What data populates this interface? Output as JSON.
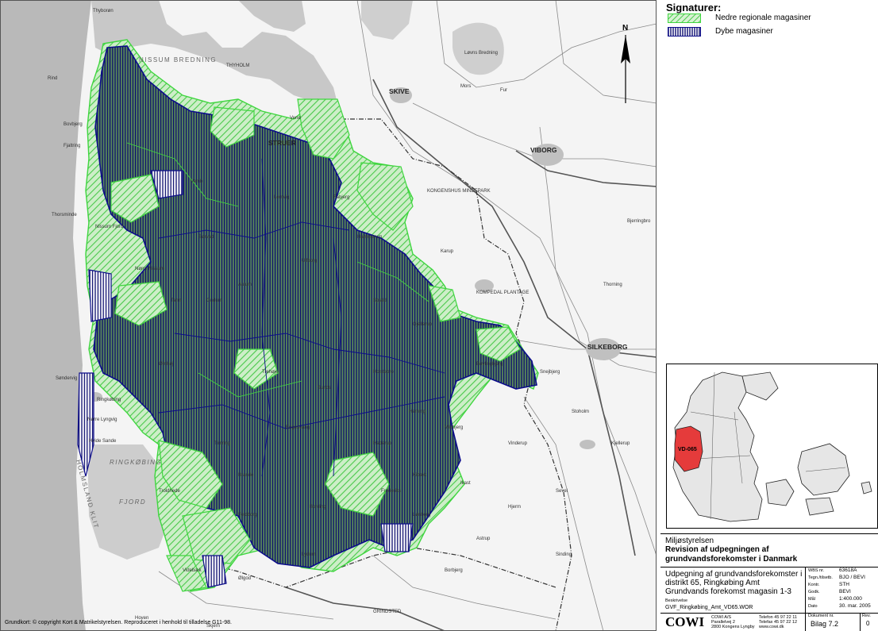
{
  "legend": {
    "title": "Signaturer:",
    "items": [
      {
        "label": "Nedre regionale magasiner",
        "color": "#3fd63f"
      },
      {
        "label": "Dybe magasiner",
        "color": "#0a0a80"
      }
    ]
  },
  "north_label": "N",
  "map_labels": {
    "cities": [
      "SKIVE",
      "VIBORG",
      "SILKEBORG",
      "STRUER"
    ],
    "waters": [
      "NISSUM BREDNING",
      "RINGKØBING",
      "FJORD",
      "Nissum Fjord",
      "Løvns Bredning"
    ],
    "coast": "HOLMSLAND KLIT",
    "places": [
      "Thyborøn",
      "THYHOLM",
      "Venø",
      "Bovbjerg",
      "Fjaltring",
      "Thorsminde",
      "Søndervig",
      "Ringkøbing",
      "Hvide Sande",
      "Nørre Lyngvig",
      "KONGENSHUS MINDEPARK",
      "KOMPEDAL PLANTAGE",
      "GRINDSTED",
      "Karup",
      "Bjerringbro",
      "Mors",
      "Fur",
      "Rind",
      "Lemvig",
      "Holstebro",
      "Herning",
      "Ikast",
      "Brande",
      "Videbæk",
      "Skjern",
      "Tarm",
      "Spjald",
      "Ulfborg",
      "Vinderup",
      "Sevel",
      "Stoholm",
      "Kjellerup",
      "Thorning",
      "Frederiks",
      "Bording",
      "Engesvang",
      "Sunds",
      "Sørvad",
      "Aulum",
      "Haderup",
      "Kibæk",
      "Ørnhøj",
      "Vemb",
      "Fabjerg",
      "Nørre Nissum",
      "Gudum",
      "Bøvlingbjerg",
      "Hjerm",
      "Borbjerg",
      "Feldborg",
      "Trehøje",
      "Hammerum",
      "Gjellerup",
      "Snejbjerg",
      "Sinding",
      "Vildbjerg",
      "Timring",
      "Troldhede",
      "Hoven",
      "Ølgod",
      "Lydum",
      "Lønborg",
      "Astrup"
    ]
  },
  "inset": {
    "region_label": "VD-065",
    "highlight_color": "#e53b3b"
  },
  "title_block": {
    "client": "Miljøstyrelsen",
    "project_title_1": "Revision af udpegningen af",
    "project_title_2": "grundvandsforekomster i Danmark",
    "drawing_title_1": "Udpegning af grundvandsforekomster i",
    "drawing_title_2": "distrikt 65, Ringkøbing Amt",
    "drawing_title_3": "Grundvands forekomst magasin 1-3",
    "file_label": "Beskrivelse",
    "file_name": "GVF_Ringkøbing_Amt_VD65.WOR",
    "fields": [
      {
        "label": "WBS nr.",
        "value": "63618A"
      },
      {
        "label": "Tegn./tilsetb.",
        "value": "BJO    /  BEVI"
      },
      {
        "label": "Kontr.",
        "value": "STH"
      },
      {
        "label": "Godk.",
        "value": "BEVI"
      },
      {
        "label": "Mål",
        "value": "1:400.000"
      },
      {
        "label": "Dato",
        "value": "30. mar. 2005"
      }
    ],
    "company": "COWI",
    "company_small_1": "COWI A/S",
    "company_small_2": "Parallelvej 2",
    "company_small_3": "2800 Kongens Lyngby",
    "phone_1": "Telefon   45 97 22 11",
    "phone_2": "Telefax   45 97 22 12",
    "phone_3": "www.cowi.dk",
    "doc_label": "Dokument nr.",
    "doc_value": "Bilag 7.2",
    "rev_label": "Rev.",
    "rev_value": "0"
  },
  "copyright": "Grundkort: © copyright Kort & Matrikelstyrelsen. Reproduceret i henhold til tilladelse G11-98."
}
